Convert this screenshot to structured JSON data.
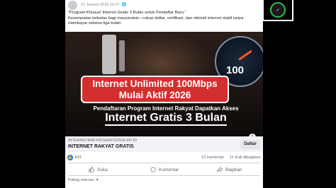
{
  "post": {
    "date": "21 Januari 2026 10:07",
    "text_line1": "\"Program Khusus! Internet Gratis 3 Bulan untuk Pendaftar Baru.\"",
    "text_line2": "Kesempatan terbatas bagi masyarakat—cukup daftar, verifikasi, dan nikmati internet stabil tanpa",
    "text_line3": "membayar selama tiga bulan."
  },
  "media": {
    "headline_line1": "Internet Unlimited 100Mbps",
    "headline_line2": "Mulai Aktif 2026",
    "subline": "Pendaftaran Program Internet Rakyat Dapatkan Akses",
    "bigline": "Internet Gratis 3 Bulan",
    "gauge_value": "100"
  },
  "link": {
    "domain": "INTERNETRAKYATGRATIS2026.MY.ID",
    "title": "INTERNET RAKYAT GRATIS",
    "button": "Daftar"
  },
  "stats": {
    "likes": "443",
    "comments": "15 komentar",
    "shares": "11 Kali dibagikan"
  },
  "actions": {
    "like": "Suka",
    "comment": "Komentar",
    "share": "Bagikan"
  },
  "sort_label": "Paling relevan",
  "colors": {
    "accent": "#1877f2",
    "headline_red": "#d32f2f"
  }
}
